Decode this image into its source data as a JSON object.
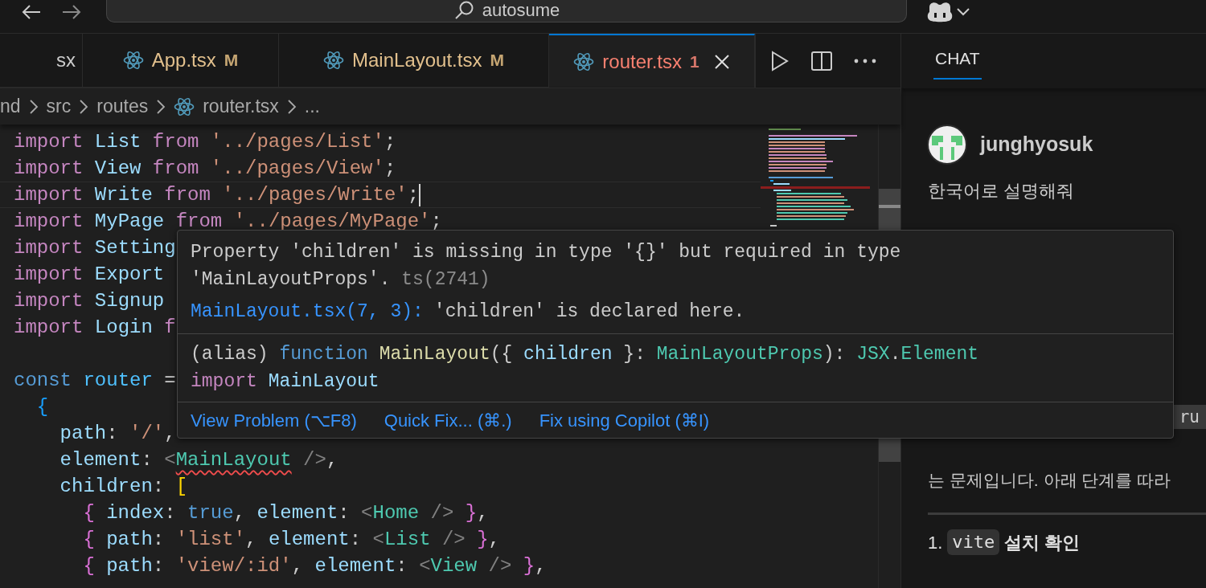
{
  "title_bar": {
    "search": {
      "value": "autosume"
    }
  },
  "tabs": [
    {
      "label": "sx",
      "kind": "plain",
      "selected": false
    },
    {
      "label": "App.tsx",
      "badge": "M",
      "kind": "modified",
      "selected": false
    },
    {
      "label": "MainLayout.tsx",
      "badge": "M",
      "kind": "modified",
      "selected": false
    },
    {
      "label": "router.tsx",
      "badge": "1",
      "kind": "error",
      "selected": true
    }
  ],
  "breadcrumb": [
    {
      "label": "nd",
      "kind": "folder"
    },
    {
      "label": "src",
      "kind": "folder"
    },
    {
      "label": "routes",
      "kind": "folder"
    },
    {
      "label": "router.tsx",
      "kind": "file"
    },
    {
      "label": "...",
      "kind": "more"
    }
  ],
  "editor": {
    "lines": [
      {
        "current": false,
        "tokens": [
          {
            "kind": "keyword",
            "text": "import "
          },
          {
            "kind": "variable",
            "text": "List "
          },
          {
            "kind": "keyword",
            "text": "from "
          },
          {
            "kind": "string",
            "text": "'../pages/List'"
          },
          {
            "kind": "punct",
            "text": ";"
          }
        ]
      },
      {
        "current": false,
        "tokens": [
          {
            "kind": "keyword",
            "text": "import "
          },
          {
            "kind": "variable",
            "text": "View "
          },
          {
            "kind": "keyword",
            "text": "from "
          },
          {
            "kind": "string",
            "text": "'../pages/View'"
          },
          {
            "kind": "punct",
            "text": ";"
          }
        ]
      },
      {
        "current": true,
        "tokens": [
          {
            "kind": "keyword",
            "text": "import "
          },
          {
            "kind": "variable",
            "text": "Write "
          },
          {
            "kind": "keyword",
            "text": "from "
          },
          {
            "kind": "string",
            "text": "'../pages/Write'"
          },
          {
            "kind": "punct",
            "text": ";"
          }
        ]
      },
      {
        "current": false,
        "tokens": [
          {
            "kind": "keyword",
            "text": "import "
          },
          {
            "kind": "variable",
            "text": "MyPage "
          },
          {
            "kind": "keyword",
            "text": "from "
          },
          {
            "kind": "string",
            "text": "'../pages/MyPage'"
          },
          {
            "kind": "punct",
            "text": ";"
          }
        ]
      },
      {
        "current": false,
        "tokens": [
          {
            "kind": "keyword",
            "text": "import "
          },
          {
            "kind": "variable",
            "text": "Setting"
          }
        ]
      },
      {
        "current": false,
        "tokens": [
          {
            "kind": "keyword",
            "text": "import "
          },
          {
            "kind": "variable",
            "text": "Export"
          }
        ]
      },
      {
        "current": false,
        "tokens": [
          {
            "kind": "keyword",
            "text": "import "
          },
          {
            "kind": "variable",
            "text": "Signup"
          }
        ]
      },
      {
        "current": false,
        "tokens": [
          {
            "kind": "keyword",
            "text": "import "
          },
          {
            "kind": "variable",
            "text": "Login "
          },
          {
            "kind": "keyword",
            "text": "f"
          }
        ]
      },
      {
        "current": false
      },
      {
        "current": false,
        "tokens": [
          {
            "kind": "storage",
            "text": "const "
          },
          {
            "kind": "constant",
            "text": "router "
          },
          {
            "kind": "punct",
            "text": "="
          }
        ]
      },
      {
        "current": false,
        "tokens": [
          {
            "kind": "bracket-blue",
            "text": "  {"
          }
        ]
      },
      {
        "current": false,
        "tokens": [
          {
            "kind": "variable",
            "text": "    path"
          },
          {
            "kind": "punct",
            "text": ": "
          },
          {
            "kind": "string",
            "text": "'/'"
          },
          {
            "kind": "punct",
            "text": ","
          }
        ]
      },
      {
        "current": false,
        "tokens": [
          {
            "kind": "variable",
            "text": "    element"
          },
          {
            "kind": "punct",
            "text": ": "
          },
          {
            "kind": "tag",
            "text": "<"
          },
          {
            "kind": "component-error",
            "text": "MainLayout"
          },
          {
            "kind": "tag",
            "text": " />"
          },
          {
            "kind": "punct",
            "text": ","
          }
        ]
      },
      {
        "current": false,
        "tokens": [
          {
            "kind": "variable",
            "text": "    children"
          },
          {
            "kind": "punct",
            "text": ": "
          },
          {
            "kind": "bracket-yellow",
            "text": "["
          }
        ]
      },
      {
        "current": false,
        "tokens": [
          {
            "kind": "bracket-pink",
            "text": "      { "
          },
          {
            "kind": "variable",
            "text": "index"
          },
          {
            "kind": "punct",
            "text": ": "
          },
          {
            "kind": "storage",
            "text": "true"
          },
          {
            "kind": "punct",
            "text": ", "
          },
          {
            "kind": "variable",
            "text": "element"
          },
          {
            "kind": "punct",
            "text": ": "
          },
          {
            "kind": "tag",
            "text": "<"
          },
          {
            "kind": "component",
            "text": "Home "
          },
          {
            "kind": "tag",
            "text": "/> "
          },
          {
            "kind": "bracket-pink",
            "text": "}"
          },
          {
            "kind": "punct",
            "text": ","
          }
        ]
      },
      {
        "current": false,
        "tokens": [
          {
            "kind": "bracket-pink",
            "text": "      { "
          },
          {
            "kind": "variable",
            "text": "path"
          },
          {
            "kind": "punct",
            "text": ": "
          },
          {
            "kind": "string",
            "text": "'list'"
          },
          {
            "kind": "punct",
            "text": ", "
          },
          {
            "kind": "variable",
            "text": "element"
          },
          {
            "kind": "punct",
            "text": ": "
          },
          {
            "kind": "tag",
            "text": "<"
          },
          {
            "kind": "component",
            "text": "List "
          },
          {
            "kind": "tag",
            "text": "/> "
          },
          {
            "kind": "bracket-pink",
            "text": "}"
          },
          {
            "kind": "punct",
            "text": ","
          }
        ]
      },
      {
        "current": false,
        "tokens": [
          {
            "kind": "bracket-pink",
            "text": "      { "
          },
          {
            "kind": "variable",
            "text": "path"
          },
          {
            "kind": "punct",
            "text": ": "
          },
          {
            "kind": "string",
            "text": "'view/:id'"
          },
          {
            "kind": "punct",
            "text": ", "
          },
          {
            "kind": "variable",
            "text": "element"
          },
          {
            "kind": "punct",
            "text": ": "
          },
          {
            "kind": "tag",
            "text": "<"
          },
          {
            "kind": "component",
            "text": "View "
          },
          {
            "kind": "tag",
            "text": "/> "
          },
          {
            "kind": "bracket-pink",
            "text": "}"
          },
          {
            "kind": "punct",
            "text": ","
          }
        ]
      }
    ]
  },
  "hover": {
    "message": "Property 'children' is missing in type '{}' but required in type 'MainLayoutProps'.",
    "code": "ts(2741)",
    "related": {
      "link": "MainLayout.tsx(7, 3):",
      "text": "'children' is declared here."
    },
    "signature": [
      [
        {
          "kind": "punct",
          "text": "(alias) "
        },
        {
          "kind": "storage",
          "text": "function "
        },
        {
          "kind": "function",
          "text": "MainLayout"
        },
        {
          "kind": "punct",
          "text": "({ "
        },
        {
          "kind": "variable",
          "text": "children"
        },
        {
          "kind": "punct",
          "text": " }: "
        },
        {
          "kind": "component",
          "text": "MainLayoutProps"
        },
        {
          "kind": "punct",
          "text": "): "
        },
        {
          "kind": "component",
          "text": "JSX"
        },
        {
          "kind": "punct",
          "text": "."
        },
        {
          "kind": "component",
          "text": "Element"
        }
      ],
      [
        {
          "kind": "keyword",
          "text": "import "
        },
        {
          "kind": "variable",
          "text": "MainLayout"
        }
      ]
    ],
    "actions": [
      "View Problem (⌥F8)",
      "Quick Fix... (⌘.)",
      "Fix using Copilot (⌘I)"
    ]
  },
  "chat": {
    "tabs": [
      {
        "label": "CHAT",
        "selected": true
      }
    ],
    "user": {
      "name": "junghyosuk",
      "message": "한국어로 설명해줘"
    },
    "response": {
      "inline_code": "ru",
      "text": "는 문제입니다. 아래 단계를 따라",
      "heading": {
        "number": "1.",
        "code": "vite",
        "text": "설치 확인"
      }
    }
  }
}
